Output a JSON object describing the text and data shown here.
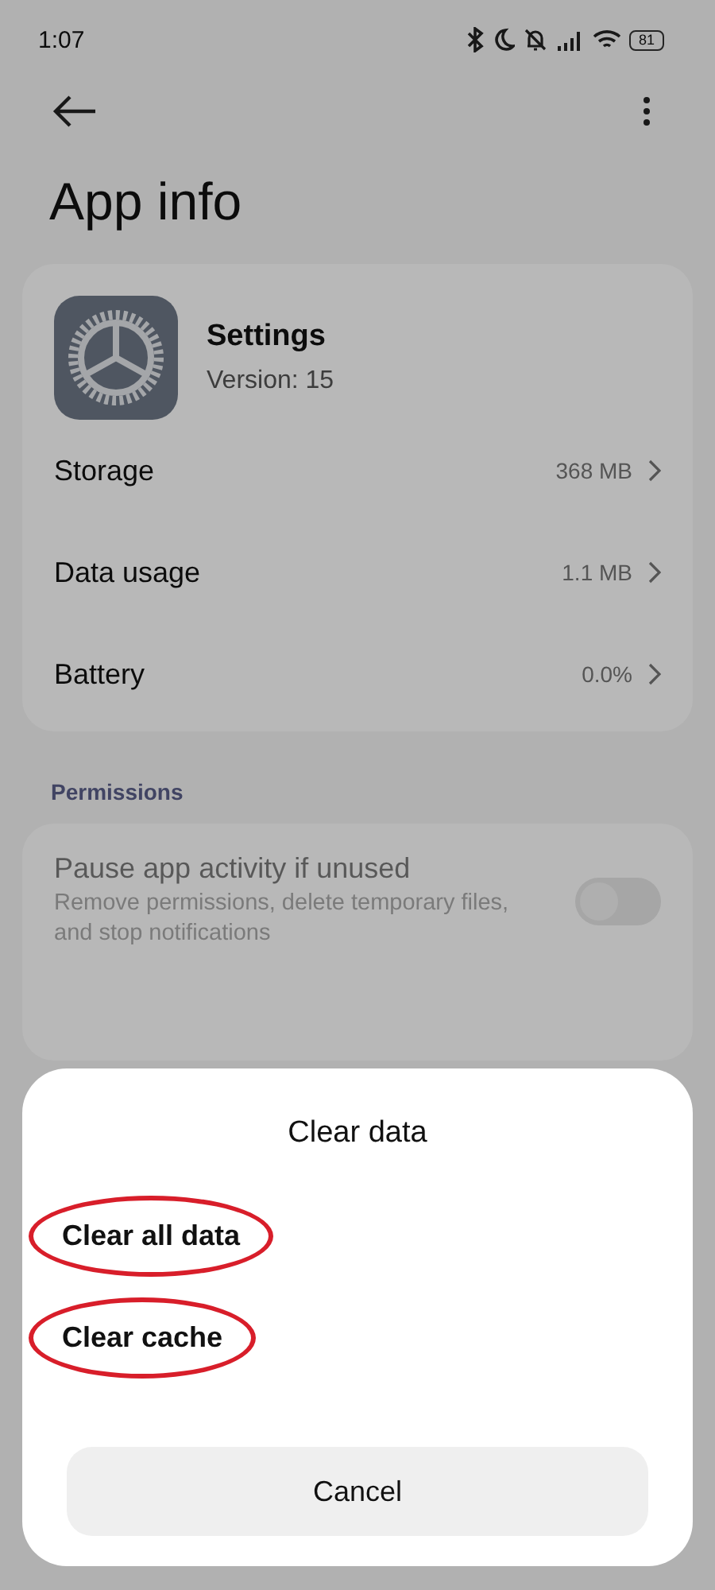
{
  "status_bar": {
    "time": "1:07",
    "battery": "81"
  },
  "title": "App info",
  "app": {
    "name": "Settings",
    "version": "Version: 15"
  },
  "rows": [
    {
      "label": "Storage",
      "value": "368 MB"
    },
    {
      "label": "Data usage",
      "value": "1.1 MB"
    },
    {
      "label": "Battery",
      "value": "0.0%"
    }
  ],
  "permissions": {
    "heading": "Permissions",
    "title": "Pause app activity if unused",
    "subtitle": "Remove permissions, delete temporary files, and stop notifications",
    "on": false,
    "disabled": true
  },
  "sheet": {
    "title": "Clear data",
    "options": [
      {
        "label": "Clear all data",
        "highlighted": true
      },
      {
        "label": "Clear cache",
        "highlighted": true
      }
    ],
    "cancel": "Cancel"
  }
}
